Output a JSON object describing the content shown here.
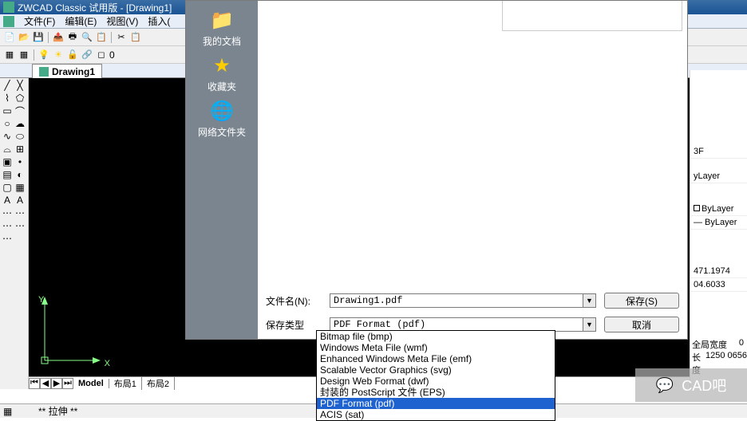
{
  "title_bar": {
    "text": "ZWCAD Classic 试用版 - [Drawing1]"
  },
  "menu": {
    "file": "文件(F)",
    "edit": "编辑(E)",
    "view": "视图(V)",
    "insert": "插入("
  },
  "toolbar2_suffix": "0",
  "doc_tab": {
    "label": "Drawing1"
  },
  "canvas_tabs": {
    "model": "Model",
    "layout1": "布局1",
    "layout2": "布局2"
  },
  "ucs": {
    "x": "X",
    "y": "Y"
  },
  "save_dialog": {
    "places": {
      "my_docs": "我的文档",
      "favorites": "收藏夹",
      "network": "网络文件夹"
    },
    "filename_label": "文件名(N):",
    "filetype_label": "保存类型",
    "filename_value": "Drawing1.pdf",
    "filetype_value": "PDF Format (pdf)",
    "save_btn": "保存(S)",
    "cancel_btn": "取消"
  },
  "format_list": [
    "Bitmap file (bmp)",
    "Windows Meta File (wmf)",
    "Enhanced Windows Meta File (emf)",
    "Scalable Vector Graphics (svg)",
    "Design Web Format (dwf)",
    "封装的 PostScript 文件 (EPS)",
    "PDF Format (pdf)",
    "ACIS (sat)"
  ],
  "right_panel": {
    "r1": "3F",
    "r2": "yLayer",
    "r3": "ByLayer",
    "r4": "— ByLayer",
    "r5": "471.1974",
    "r6": "04.6033",
    "r7": "0",
    "width_label": "全局宽度",
    "length_label": "长度",
    "length_val": "1250 0656"
  },
  "command_line": "** 拉伸 **",
  "watermark": {
    "text": "CAD吧"
  }
}
